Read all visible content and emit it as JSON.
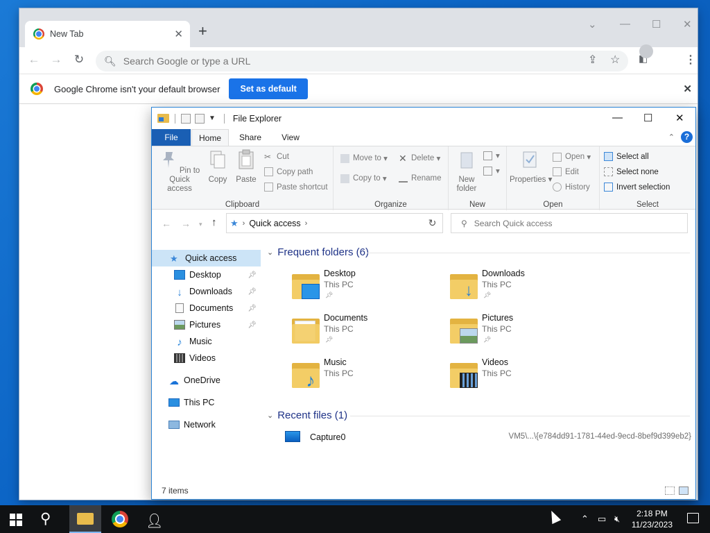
{
  "chrome": {
    "tab_title": "New Tab",
    "omnibox_placeholder": "Search Google or type a URL",
    "infobar": {
      "message": "Google Chrome isn't your default browser",
      "button_label": "Set as default"
    }
  },
  "explorer": {
    "title": "File Explorer",
    "ribbon_tabs": [
      "File",
      "Home",
      "Share",
      "View"
    ],
    "ribbon": {
      "clipboard": {
        "label": "Clipboard",
        "pin": "Pin to Quick access",
        "copy": "Copy",
        "paste": "Paste",
        "cut": "Cut",
        "copy_path": "Copy path",
        "paste_shortcut": "Paste shortcut"
      },
      "organize": {
        "label": "Organize",
        "move_to": "Move to",
        "copy_to": "Copy to",
        "delete": "Delete",
        "rename": "Rename"
      },
      "new": {
        "label": "New",
        "new_folder": "New folder"
      },
      "open": {
        "label": "Open",
        "properties": "Properties",
        "open": "Open",
        "edit": "Edit",
        "history": "History"
      },
      "select": {
        "label": "Select",
        "select_all": "Select all",
        "select_none": "Select none",
        "invert": "Invert selection"
      }
    },
    "address": {
      "crumb": "Quick access"
    },
    "search_placeholder": "Search Quick access",
    "nav_pane": {
      "quick_access": "Quick access",
      "items": [
        "Desktop",
        "Downloads",
        "Documents",
        "Pictures",
        "Music",
        "Videos"
      ],
      "onedrive": "OneDrive",
      "this_pc": "This PC",
      "network": "Network"
    },
    "frequent_header": "Frequent folders (6)",
    "folders": [
      {
        "name": "Desktop",
        "location": "This PC"
      },
      {
        "name": "Downloads",
        "location": "This PC"
      },
      {
        "name": "Documents",
        "location": "This PC"
      },
      {
        "name": "Pictures",
        "location": "This PC"
      },
      {
        "name": "Music",
        "location": "This PC"
      },
      {
        "name": "Videos",
        "location": "This PC"
      }
    ],
    "recent_header": "Recent files (1)",
    "recent": [
      {
        "name": "Capture0",
        "path": "VM5\\...\\{e784dd91-1781-44ed-9ecd-8bef9d399eb2}"
      }
    ],
    "status_count": "7 items"
  },
  "taskbar": {
    "time": "2:18 PM",
    "date": "11/23/2023"
  },
  "colors": {
    "accent": "#1a73e8",
    "file_tab": "#1a5fb4",
    "selection": "#cce4f7",
    "section_header": "#1e3287",
    "taskbar": "#101214"
  }
}
